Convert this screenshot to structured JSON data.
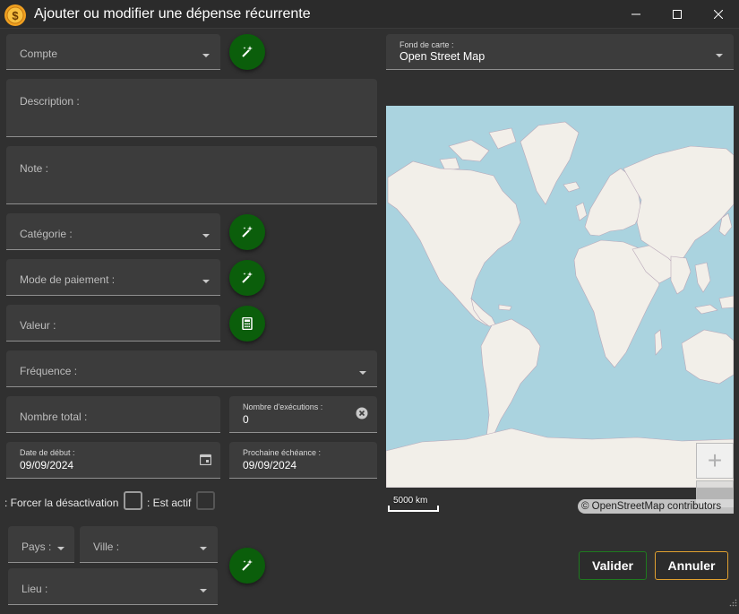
{
  "window": {
    "title": "Ajouter ou modifier une dépense récurrente",
    "app_icon": "dollar-coin-icon",
    "controls": [
      "minimize-icon",
      "maximize-icon",
      "close-icon"
    ]
  },
  "form": {
    "compte": {
      "label": "Compte",
      "value": ""
    },
    "description": {
      "label": "Description :",
      "value": ""
    },
    "note": {
      "label": "Note :",
      "value": ""
    },
    "categorie": {
      "label": "Catégorie :",
      "value": ""
    },
    "mode_paiement": {
      "label": "Mode de paiement :",
      "value": ""
    },
    "valeur": {
      "label": "Valeur :",
      "value": ""
    },
    "frequence": {
      "label": "Fréquence :",
      "value": ""
    },
    "nombre_total": {
      "label": "Nombre total :",
      "value": ""
    },
    "nombre_executions": {
      "label": "Nombre d'exécutions :",
      "value": "0"
    },
    "date_debut": {
      "label": "Date de début :",
      "value": "09/09/2024"
    },
    "prochaine_echeance": {
      "label": "Prochaine échéance :",
      "value": "09/09/2024"
    },
    "forcer_desactivation": {
      "label": ": Forcer la désactivation",
      "checked": false
    },
    "est_actif": {
      "label": ": Est actif",
      "checked": false,
      "enabled": false
    },
    "pays": {
      "label": "Pays :",
      "value": ""
    },
    "ville": {
      "label": "Ville :",
      "value": ""
    },
    "lieu": {
      "label": "Lieu :",
      "value": ""
    }
  },
  "map": {
    "basemap_label": "Fond de carte :",
    "basemap_value": "Open Street Map",
    "scale_label": "5000 km",
    "attribution": "© OpenStreetMap contributors",
    "zoom_in": "+",
    "colors": {
      "water": "#aad3df",
      "land": "#f2efe9",
      "border": "#b9a8b9"
    }
  },
  "actions": {
    "ok_label": "Valider",
    "cancel_label": "Annuler"
  },
  "colors": {
    "background": "#303030",
    "field": "#3c3c3c",
    "fab": "#0b5e0b",
    "ok_border": "#1f7a1f",
    "cancel_border": "#e0a030"
  }
}
